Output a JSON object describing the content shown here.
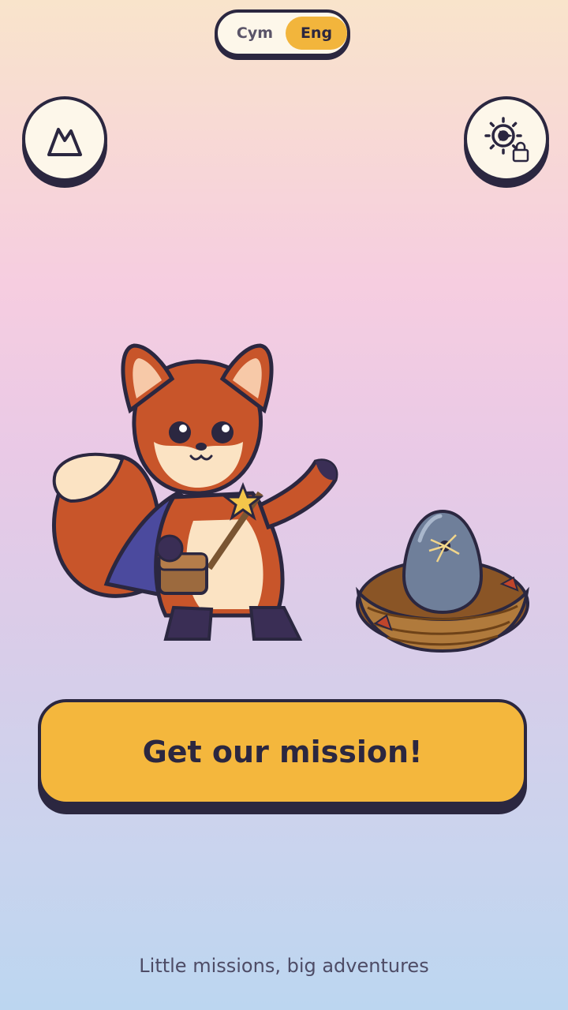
{
  "language_toggle": {
    "option_welsh": "Cym",
    "option_english": "Eng",
    "selected": "Eng"
  },
  "top_buttons": {
    "left_icon": "mountain-icon",
    "right_icon": "gear-lock-icon"
  },
  "mission_button": {
    "label": "Get our mission!"
  },
  "tagline": "Little missions, big adventures",
  "colors": {
    "accent": "#f4b73d",
    "outline": "#2b2740",
    "button_fill": "#fdf7ea",
    "fox_orange": "#c8552a",
    "cape": "#4b4a9e",
    "egg": "#6f7f9a"
  }
}
